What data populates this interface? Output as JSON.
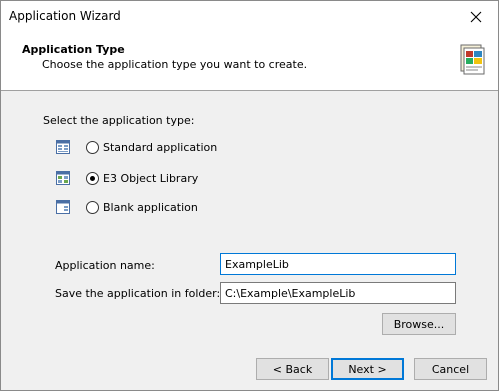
{
  "window": {
    "title": "Application Wizard",
    "close_icon": "close-icon"
  },
  "header": {
    "title": "Application Type",
    "subtitle": "Choose the application type you want to create.",
    "icon": "wizard-document-icon"
  },
  "app_type": {
    "prompt": "Select the application type:",
    "options": [
      {
        "label": "Standard application",
        "icon": "standard-app-icon",
        "selected": false
      },
      {
        "label": "E3 Object Library",
        "icon": "object-library-icon",
        "selected": true
      },
      {
        "label": "Blank application",
        "icon": "blank-app-icon",
        "selected": false
      }
    ]
  },
  "form": {
    "name_label": "Application name:",
    "name_value": "ExampleLib",
    "folder_label": "Save the application in folder:",
    "folder_value": "C:\\Example\\ExampleLib",
    "browse_label": "Browse..."
  },
  "buttons": {
    "back": "< Back",
    "next": "Next >",
    "cancel": "Cancel"
  },
  "colors": {
    "focus_accent": "#0078d7",
    "dialog_bg": "#f0f0f0",
    "header_bg": "#ffffff"
  }
}
